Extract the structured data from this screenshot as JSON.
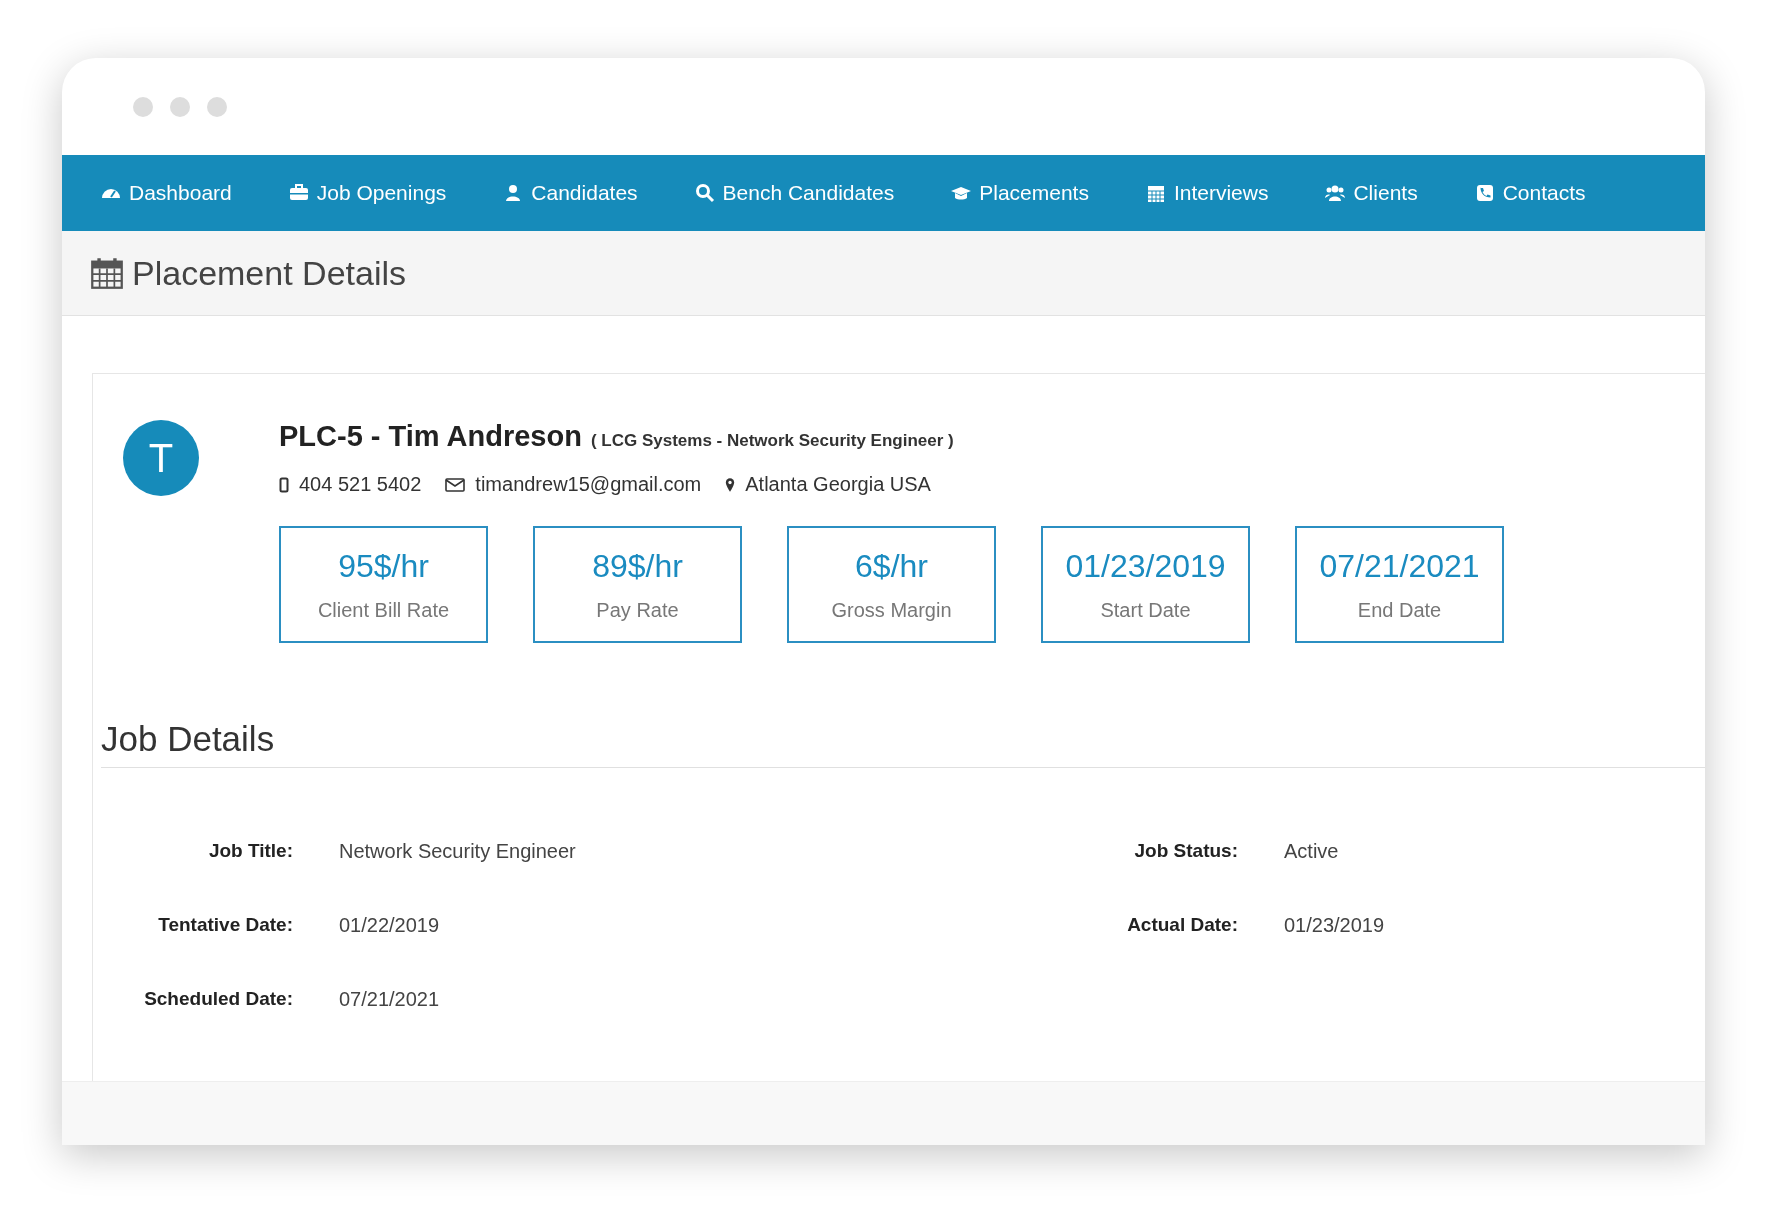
{
  "nav": [
    {
      "label": "Dashboard"
    },
    {
      "label": "Job Openings"
    },
    {
      "label": "Candidates"
    },
    {
      "label": "Bench Candidates"
    },
    {
      "label": "Placements"
    },
    {
      "label": "Interviews"
    },
    {
      "label": "Clients"
    },
    {
      "label": "Contacts"
    }
  ],
  "page_title": "Placement Details",
  "profile": {
    "initial": "T",
    "name": "PLC-5 - Tim Andreson",
    "subtitle": "( LCG Systems - Network Security Engineer )",
    "phone": "404 521 5402",
    "email": "timandrew15@gmail.com",
    "location": "Atlanta Georgia USA"
  },
  "stats": [
    {
      "value": "95$/hr",
      "label": "Client Bill Rate"
    },
    {
      "value": "89$/hr",
      "label": "Pay Rate"
    },
    {
      "value": "6$/hr",
      "label": "Gross Margin"
    },
    {
      "value": "01/23/2019",
      "label": "Start Date"
    },
    {
      "value": "07/21/2021",
      "label": "End Date"
    }
  ],
  "job_details": {
    "title": "Job Details",
    "rows": [
      [
        {
          "label": "Job Title:",
          "value": "Network Security Engineer"
        },
        {
          "label": "Job Status:",
          "value": "Active"
        }
      ],
      [
        {
          "label": "Tentative Date:",
          "value": "01/22/2019"
        },
        {
          "label": "Actual Date:",
          "value": "01/23/2019"
        }
      ],
      [
        {
          "label": "Scheduled Date:",
          "value": "07/21/2021"
        }
      ]
    ]
  }
}
